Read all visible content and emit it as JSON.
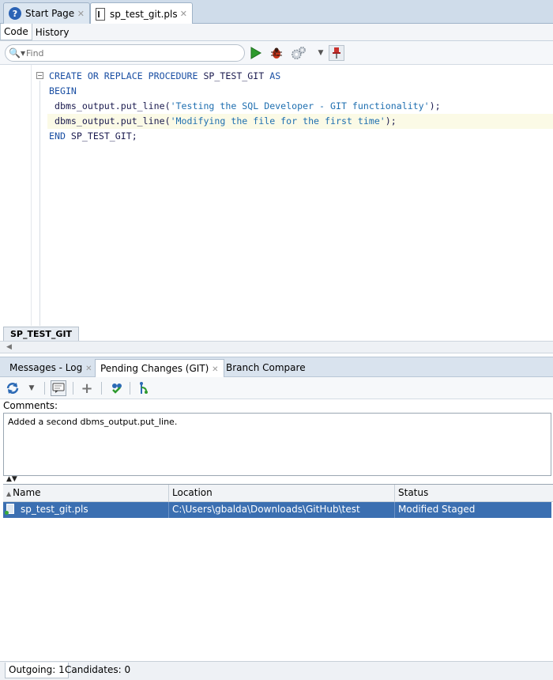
{
  "doc_tabs": [
    {
      "label": "Start Page",
      "icon": "help-icon"
    },
    {
      "label": "sp_test_git.pls",
      "icon": "file-icon"
    }
  ],
  "editor_subtabs": [
    "Code",
    "History"
  ],
  "find": {
    "placeholder": "Find"
  },
  "code_lines": [
    {
      "kw1": "CREATE OR REPLACE PROCEDURE",
      "rest": " SP_TEST_GIT ",
      "kw2": "AS"
    },
    {
      "kw1": "BEGIN"
    },
    {
      "prefix": " dbms_output.put_line(",
      "str": "'Testing the SQL Developer - GIT functionality'",
      "suffix": ");"
    },
    {
      "prefix": " dbms_output.put_line(",
      "str": "'Modifying the file for the first time'",
      "suffix": ");"
    },
    {
      "kw1": "END",
      "rest": " SP_TEST_GIT;"
    }
  ],
  "procedure_tab": "SP_TEST_GIT",
  "log_tabs": [
    "Messages - Log",
    "Pending Changes (GIT)",
    "Branch Compare"
  ],
  "comments": {
    "label": "Comments:",
    "value": "Added a second dbms_output.put_line."
  },
  "table": {
    "columns": [
      "Name",
      "Location",
      "Status"
    ],
    "rows": [
      {
        "name": "sp_test_git.pls",
        "location": "C:\\Users\\gbalda\\Downloads\\GitHub\\test",
        "status": "Modified Staged"
      }
    ]
  },
  "bottom_tabs": [
    "Outgoing: 1",
    "Candidates: 0"
  ],
  "colors": {
    "selection": "#3b6fb1",
    "keyword": "#1a4fa3",
    "string": "#1f6fb0",
    "run_green": "#2e9a2e"
  }
}
